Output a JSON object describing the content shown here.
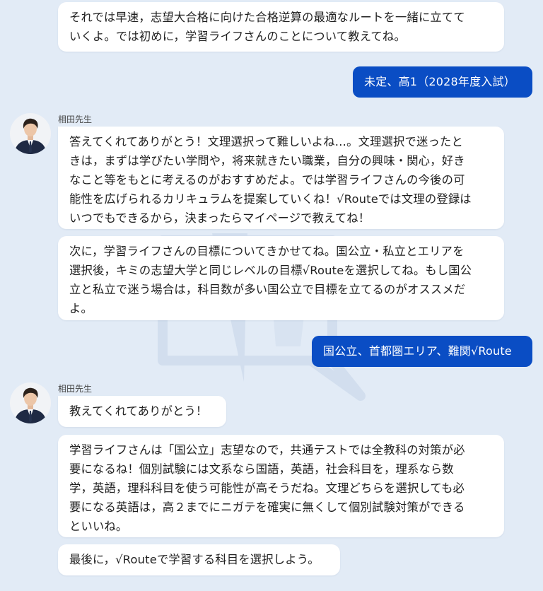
{
  "teacher_name": "相田先生",
  "conversation": {
    "m0": [
      "それでは早速，志望大合格に向けた合格逆算の最適なルートを一緒に立てて",
      "いくよ。では初めに，学習ライフさんのことについて教えてね。"
    ],
    "u1": "未定、高1（2028年度入試）",
    "m2": [
      "答えてくれてありがとう！文理選択って難しいよね…。文理選択で迷ったと",
      "きは，まずは学びたい学問や，将来就きたい職業，自分の興味・関心，好き",
      "なこと等をもとに考えるのがおすすめだよ。では学習ライフさんの今後の可",
      "能性を広げられるカリキュラムを提案していくね！√Routeでは文理の登録は",
      "いつでもできるから，決まったらマイページで教えてね！"
    ],
    "m3": [
      "次に，学習ライフさんの目標についてきかせてね。国公立・私立とエリアを",
      "選択後，キミの志望大学と同じレベルの目標√Routeを選択してね。もし国公",
      "立と私立で迷う場合は，科目数が多い国公立で目標を立てるのがオススメだ",
      "よ。"
    ],
    "u4": "国公立、首都圏エリア、難関√Route",
    "m5": [
      "教えてくれてありがとう！"
    ],
    "m6": [
      "学習ライフさんは「国公立」志望なので，共通テストでは全教科の対策が必",
      "要になるね！個別試験には文系なら国語，英語，社会科目を，理系なら数",
      "学，英語，理科科目を使う可能性が高そうだね。文理どちらを選択しても必",
      "要になる英語は，高２までにニガテを確実に無くして個別試験対策ができる",
      "といいね。"
    ],
    "m7": [
      "最後に，√Routeで学習する科目を選択しよう。"
    ]
  },
  "colors": {
    "background": "#e2ebf6",
    "user_bubble": "#0a4dc4",
    "bot_bubble": "#ffffff"
  }
}
